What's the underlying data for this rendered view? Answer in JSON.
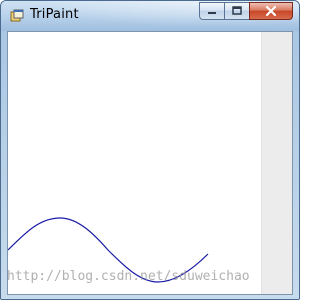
{
  "window": {
    "title": "TriPaint",
    "minimize_label": "Minimize",
    "maximize_label": "Maximize",
    "close_label": "Close"
  },
  "icons": {
    "app": "app-window-icon",
    "minimize": "minimize-icon",
    "maximize": "maximize-icon",
    "close": "close-icon"
  },
  "colors": {
    "curve": "#1a1aa8",
    "close_button": "#c7462a"
  },
  "watermark": {
    "text": "http://blog.csdn.net/sduweichao"
  }
}
